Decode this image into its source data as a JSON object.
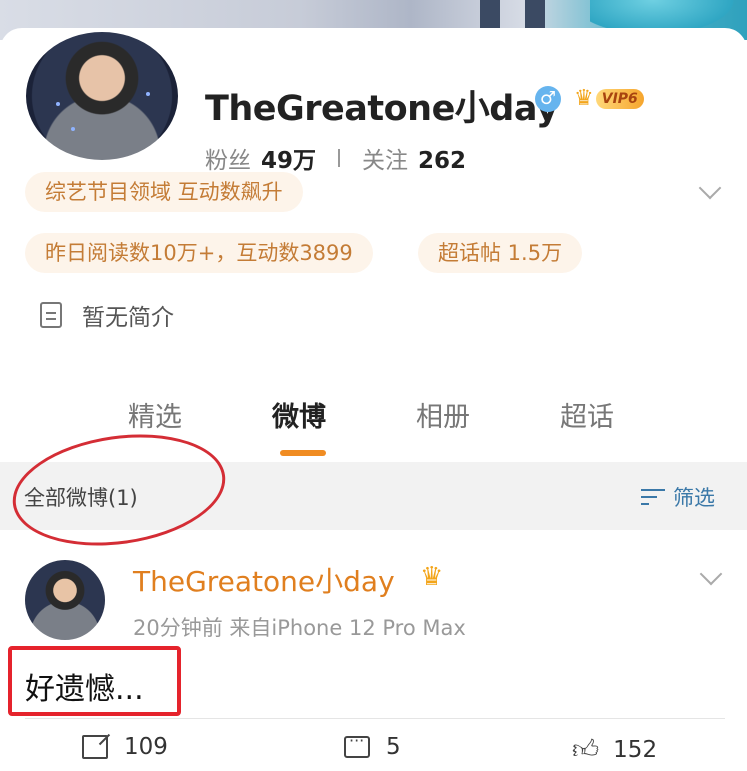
{
  "profile": {
    "name": "TheGreatone小day",
    "gender_icon": "male-icon",
    "vip_label": "VIP6",
    "fans_label": "粉丝",
    "fans_value": "49万",
    "follow_label": "关注",
    "follow_value": "262",
    "tags": [
      "综艺节目领域 互动数飙升",
      "昨日阅读数10万+，互动数3899",
      "超话帖 1.5万"
    ],
    "intro": "暂无简介"
  },
  "tabs": [
    {
      "label": "精选",
      "active": false
    },
    {
      "label": "微博",
      "active": true
    },
    {
      "label": "相册",
      "active": false
    },
    {
      "label": "超话",
      "active": false
    }
  ],
  "filterbar": {
    "all_label": "全部微博(1)",
    "filter_label": "筛选"
  },
  "post": {
    "author": "TheGreatone小day",
    "meta": "20分钟前  来自iPhone 12 Pro Max",
    "text": "好遗憾...",
    "reposts": "109",
    "comments": "5",
    "likes": "152"
  },
  "colors": {
    "accent": "#f08c22",
    "tag_text": "#c47c36",
    "tag_bg": "#fdf4ea",
    "link_blue": "#3a78a8",
    "annotation_red": "#e5232c"
  }
}
